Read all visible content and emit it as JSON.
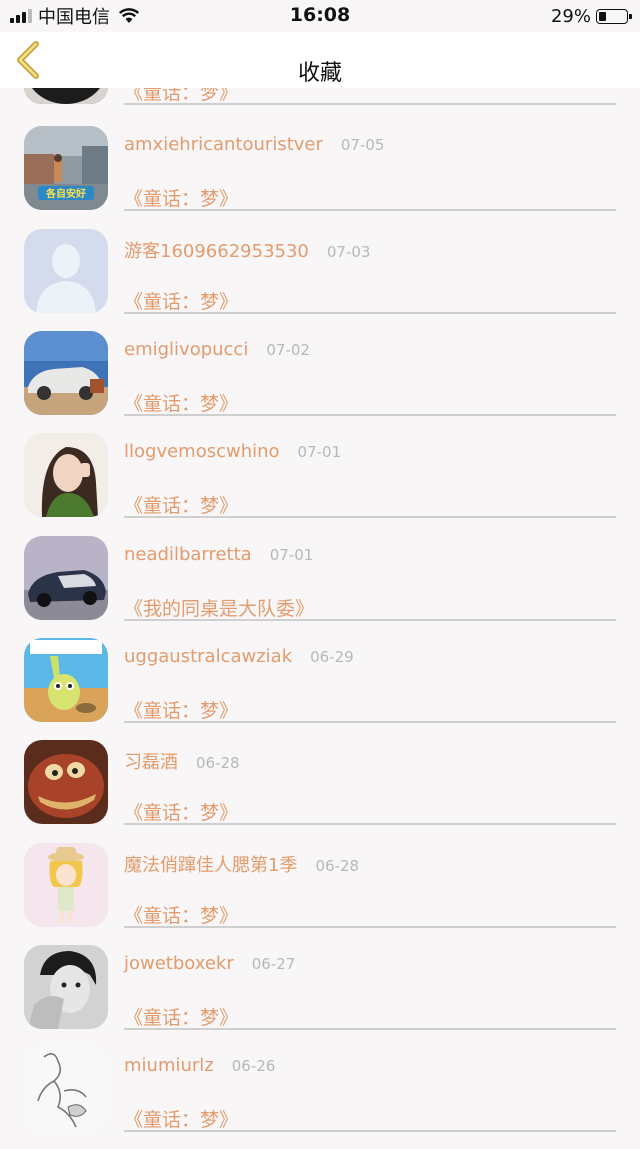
{
  "status_bar": {
    "carrier": "中国电信",
    "time": "16:08",
    "battery": "29%",
    "battery_level": 0.29
  },
  "nav": {
    "title": "收藏"
  },
  "top_partial_item": {
    "title": "《童话：梦》"
  },
  "items": [
    {
      "name": "amxiehricantouristver",
      "date": "07-05",
      "title": "《童话：梦》",
      "avatar": "street-scene-avatar",
      "avatar_caption": "各自安好"
    },
    {
      "name": "游客1609662953530",
      "date": "07-03",
      "title": "《童话：梦》",
      "avatar": "default-user-avatar"
    },
    {
      "name": "emiglivopucci",
      "date": "07-02",
      "title": "《童话：梦》",
      "avatar": "car-beach-avatar"
    },
    {
      "name": "llogvemoscwhino",
      "date": "07-01",
      "title": "《童话：梦》",
      "avatar": "girl-portrait-avatar"
    },
    {
      "name": "neadilbarretta",
      "date": "07-01",
      "title": "《我的同桌是大队委》",
      "avatar": "sports-car-avatar"
    },
    {
      "name": "uggaustralcawziak",
      "date": "06-29",
      "title": "《童话：梦》",
      "avatar": "cartoon-rabbit-avatar"
    },
    {
      "name": "习磊酒",
      "date": "06-28",
      "title": "《童话：梦》",
      "avatar": "cartoon-monster-avatar"
    },
    {
      "name": "魔法俏蹿佳人腮第1季",
      "date": "06-28",
      "title": "《童话：梦》",
      "avatar": "cartoon-girl-hat-avatar"
    },
    {
      "name": "jowetboxekr",
      "date": "06-27",
      "title": "《童话：梦》",
      "avatar": "bw-portrait-avatar"
    },
    {
      "name": "miumiurlz",
      "date": "06-26",
      "title": "《童话：梦》",
      "avatar": "sketch-figure-avatar"
    }
  ],
  "colors": {
    "accent": "#e29c6d",
    "date": "#b8b8b8",
    "divider": "#cfcfcf",
    "background": "#f8f6f7",
    "back_chevron": "#c9a23a"
  },
  "icons": {
    "back": "chevron-left-icon",
    "wifi": "wifi-icon",
    "signal": "signal-icon",
    "battery": "battery-icon"
  }
}
